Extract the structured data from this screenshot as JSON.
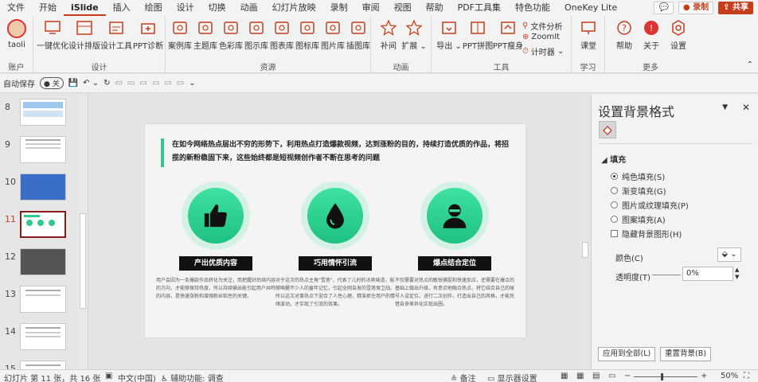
{
  "tabs": [
    "文件",
    "开始",
    "iSlide",
    "插入",
    "绘图",
    "设计",
    "切换",
    "动画",
    "幻灯片放映",
    "录制",
    "审阅",
    "视图",
    "帮助",
    "PDF工具集",
    "特色功能",
    "OneKey Lite"
  ],
  "active_tab": "iSlide",
  "tabbar_right": {
    "record": "录制",
    "share": "共享"
  },
  "ribbon": {
    "account": {
      "user": "taoli",
      "title": "账户"
    },
    "design": {
      "title": "设计",
      "buttons": [
        "一键优化",
        "设计排版",
        "设计工具",
        "PPT诊断"
      ]
    },
    "resources": {
      "title": "资源",
      "buttons": [
        "案例库",
        "主题库",
        "色彩库",
        "图示库",
        "图表库",
        "图标库",
        "图片库",
        "插图库"
      ]
    },
    "animation": {
      "title": "动画",
      "buttons": [
        "补间",
        "扩展"
      ]
    },
    "tools": {
      "title": "工具",
      "buttons": [
        "导出",
        "PPT拼图",
        "PPT瘦身"
      ],
      "small": [
        "文件分析",
        "ZoomIt",
        "计时器"
      ]
    },
    "learn": {
      "title": "学习",
      "buttons": [
        "课堂"
      ]
    },
    "more": {
      "title": "更多",
      "buttons": [
        "帮助",
        "关于",
        "设置"
      ]
    }
  },
  "qat": {
    "autosave": "自动保存",
    "autosave_state": "关"
  },
  "thumbnails": [
    {
      "num": "8",
      "current": false
    },
    {
      "num": "9",
      "current": false
    },
    {
      "num": "10",
      "current": false
    },
    {
      "num": "11",
      "current": true
    },
    {
      "num": "12",
      "current": false
    },
    {
      "num": "13",
      "current": false
    },
    {
      "num": "14",
      "current": false
    },
    {
      "num": "15",
      "current": false
    }
  ],
  "slide": {
    "headline": "在如今网络热点层出不穷的形势下，利用热点打造爆款视频，达到涨粉的目的，持续打造优质的作品，将招揽的新粉稳固下来，这些始终都是短视频创作者不断在思考的问题",
    "features": [
      {
        "icon": "thumbs-up-icon",
        "label": "产出优质内容",
        "desc": "用户会因为一条爆款作品转化为关注，而把握好后续内容的方向，才能够保持热度，所以持续输出能引起用户共鸣的内容，是快速涨粉和增强粉丝粘性的关键。"
      },
      {
        "icon": "drop-icon",
        "label": "巧用情怀引流",
        "desc": "对于这次的热点主角\"雪莲\"，代表了儿时的冰爽味道，能够唤醒不少人的童年记忆，引起全网自发的雪莲保卫战。所以这次对事热点下迎合了人性心理，精准抓住用户的情绪波动，才实现了引流的效果。"
      },
      {
        "icon": "person-icon",
        "label": "爆点结合定位",
        "desc": "不仅需要对热点的敏锐捕捉和快速反应，还需要在爆点的基础上做出升级，有意识地融合热点，将它结合自己的账号人设定位，进行二次创作，打造出自己的风格，才能凭借自身差异化实现出圈。"
      }
    ]
  },
  "pane": {
    "title": "设置背景格式",
    "section": "填充",
    "options": [
      {
        "label": "纯色填充(S)",
        "type": "radio",
        "checked": true
      },
      {
        "label": "渐变填充(G)",
        "type": "radio",
        "checked": false
      },
      {
        "label": "图片或纹理填充(P)",
        "type": "radio",
        "checked": false
      },
      {
        "label": "图案填充(A)",
        "type": "radio",
        "checked": false
      },
      {
        "label": "隐藏背景图形(H)",
        "type": "checkbox",
        "checked": false
      }
    ],
    "color_label": "颜色(C)",
    "transparency_label": "透明度(T)",
    "transparency_value": "0%",
    "apply_all": "应用到全部(L)",
    "reset": "重置背景(B)"
  },
  "status": {
    "slide_info": "幻灯片 第 11 张，共 16 张",
    "language": "中文(中国)",
    "accessibility": "辅助功能: 调查",
    "notes": "备注",
    "display": "显示器设置",
    "zoom": "50%"
  },
  "colors": {
    "accent": "#c43e1c",
    "green": "#2fc98a"
  }
}
